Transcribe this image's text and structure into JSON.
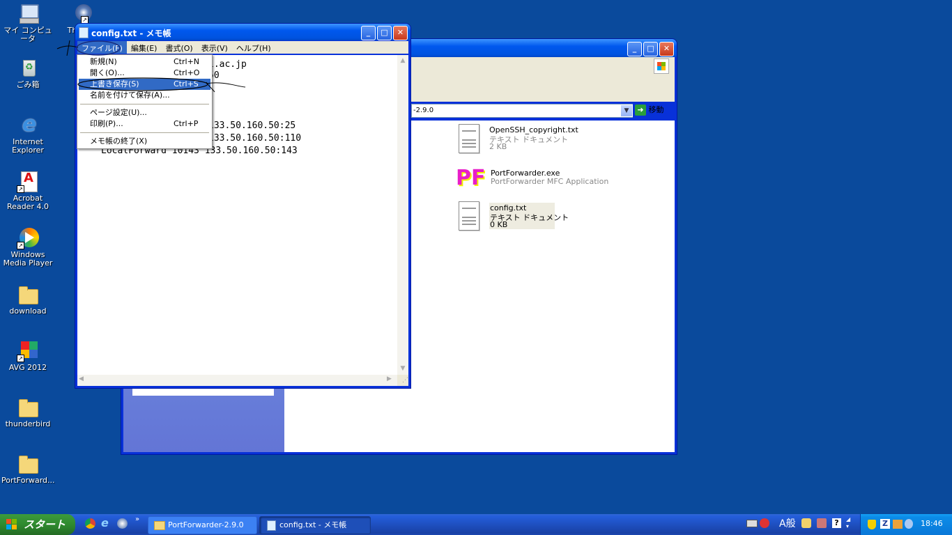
{
  "desktop": {
    "icons": [
      {
        "label": "マイ コンピュータ",
        "icon": "computer-icon"
      },
      {
        "label": "ごみ箱",
        "icon": "recycle-bin-icon"
      },
      {
        "label": "Internet Explorer",
        "icon": "internet-explorer-icon"
      },
      {
        "label": "Acrobat Reader 4.0",
        "icon": "acrobat-icon"
      },
      {
        "label": "Windows Media Player",
        "icon": "media-player-icon"
      },
      {
        "label": "download",
        "icon": "folder-icon"
      },
      {
        "label": "AVG 2012",
        "icon": "avg-icon"
      },
      {
        "label": "thunderbird",
        "icon": "folder-icon"
      },
      {
        "label": "PortForward...",
        "icon": "folder-icon"
      }
    ],
    "partial_icon_label": "Thu"
  },
  "explorer": {
    "address_value": "-2.9.0",
    "go_label": "移動",
    "files": [
      {
        "name": "OpenSSH_copyright.txt",
        "type": "テキスト ドキュメント",
        "size": "2 KB",
        "icon": "text-file-icon"
      },
      {
        "name": "PortForwarder.exe",
        "type": "PortForwarder MFC Application",
        "size": "",
        "icon": "portforwarder-icon"
      },
      {
        "name": "config.txt",
        "type": "テキスト ドキュメント",
        "size": "0 KB",
        "icon": "text-file-icon"
      }
    ]
  },
  "notepad": {
    "title": "config.txt - メモ帳",
    "menu": [
      "ファイル(F)",
      "編集(E)",
      "書式(O)",
      "表示(V)",
      "ヘルプ(H)"
    ],
    "text_lines": [
      "i.ac.jp",
      "50",
      "133.50.160.50:25",
      "133.50.160.50:110",
      "LocalForward 10143 133.50.160.50:143"
    ],
    "file_menu": [
      {
        "label": "新規(N)",
        "shortcut": "Ctrl+N"
      },
      {
        "label": "開く(O)...",
        "shortcut": "Ctrl+O"
      },
      {
        "label": "上書き保存(S)",
        "shortcut": "Ctrl+S",
        "selected": true
      },
      {
        "label": "名前を付けて保存(A)...",
        "shortcut": ""
      },
      {
        "label": "ページ設定(U)...",
        "shortcut": ""
      },
      {
        "label": "印刷(P)...",
        "shortcut": "Ctrl+P"
      },
      {
        "label": "メモ帳の終了(X)",
        "shortcut": ""
      }
    ]
  },
  "taskbar": {
    "start_label": "スタート",
    "items": [
      {
        "label": "PortForwarder-2.9.0",
        "icon": "folder-icon"
      },
      {
        "label": "config.txt - メモ帳",
        "icon": "notepad-icon"
      }
    ],
    "ime": "A般",
    "clock": "18:46"
  },
  "colors": {
    "desktop": "#0a4a9c",
    "xp_blue": "#0058ee",
    "menu_highlight": "#316ac5",
    "start_green": "#2f8a2f"
  }
}
